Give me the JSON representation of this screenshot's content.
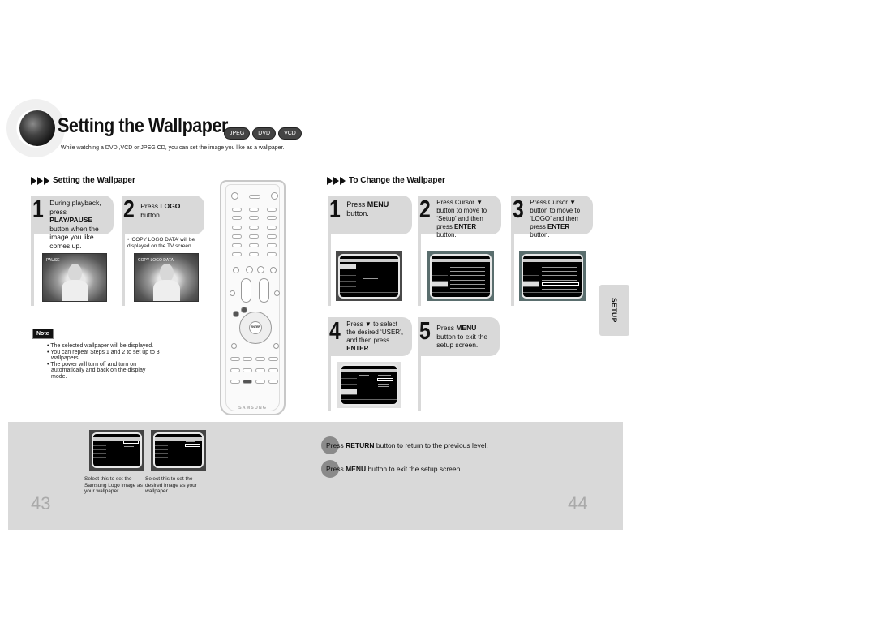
{
  "header": {
    "title": "Setting the Wallpaper",
    "badges": [
      "JPEG",
      "DVD",
      "VCD"
    ],
    "subtitle": "While watching a DVD,,VCD or JPEG CD, you can set the image you like as a wallpaper."
  },
  "left_section": {
    "heading": "Setting the Wallpaper",
    "steps": [
      {
        "number": "1",
        "text_parts": [
          "During playback, press ",
          "PLAY/PAUSE",
          " button when the image you like comes up."
        ],
        "screen_label": "PAUSE"
      },
      {
        "number": "2",
        "text_parts": [
          "Press ",
          "LOGO",
          " button."
        ],
        "bullet": "‘COPY LOGO DATA’ will be displayed on the TV screen.",
        "screen_label": "COPY LOGO DATA"
      }
    ],
    "note_label": "Note",
    "notes": [
      "The selected wallpaper will be displayed.",
      "You can repeat Steps 1 and 2 to set up to 3 wallpapers.",
      "The power will turn off and turn on automatically and back on the display mode."
    ]
  },
  "remote": {
    "brand": "SAMSUNG",
    "enter_label": "ENTER"
  },
  "right_section": {
    "heading": "To Change the Wallpaper",
    "steps": [
      {
        "number": "1",
        "text_parts": [
          "Press ",
          "MENU",
          " button."
        ]
      },
      {
        "number": "2",
        "text_parts": [
          "Press Cursor ▼ button to move to ‘Setup’ and then press ",
          "ENTER",
          " button."
        ]
      },
      {
        "number": "3",
        "text_parts": [
          "Press Cursor ▼ button to move to ‘LOGO’ and then press ",
          "ENTER",
          " button."
        ]
      },
      {
        "number": "4",
        "text_parts": [
          "Press ▼ to select the desired ‘USER’, and then press ",
          "ENTER",
          "."
        ]
      },
      {
        "number": "5",
        "text_parts": [
          "Press ",
          "MENU",
          " button to exit the setup screen."
        ]
      }
    ]
  },
  "side_tab": {
    "label": "SETUP"
  },
  "bottom": {
    "captions": [
      "Select this to set the Samsung Logo image as your wallpaper.",
      "Select this to set the desired image as your wallpaper."
    ],
    "tips": [
      {
        "pre": "Press ",
        "key": "RETURN",
        "post": " button to return to the previous level."
      },
      {
        "pre": "Press ",
        "key": "MENU",
        "post": " button to exit the setup screen."
      }
    ],
    "page_left": "43",
    "page_right": "44"
  }
}
